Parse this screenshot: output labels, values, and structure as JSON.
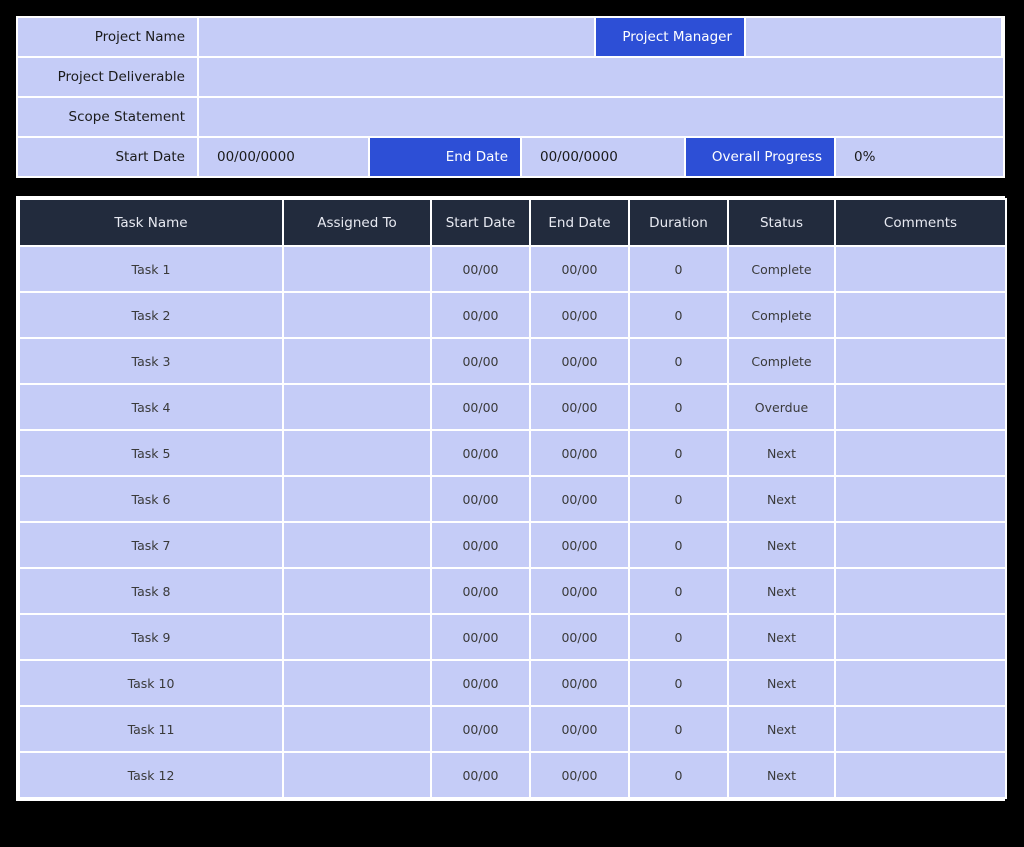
{
  "summary": {
    "rows": [
      {
        "label": "Project Name",
        "value": "",
        "accent_label": "Project Manager",
        "accent_value": ""
      },
      {
        "label": "Project Deliverable",
        "value": ""
      },
      {
        "label": "Scope Statement",
        "value": ""
      },
      {
        "label": "Start Date",
        "value": "00/00/0000",
        "end_date_label": "End Date",
        "end_date_value": "00/00/0000",
        "progress_label": "Overall Progress",
        "progress_value": "0%"
      }
    ]
  },
  "task_table": {
    "columns": [
      "Task Name",
      "Assigned To",
      "Start Date",
      "End Date",
      "Duration",
      "Status",
      "Comments"
    ],
    "rows": [
      {
        "task": "Task 1",
        "assigned": "",
        "start": "00/00",
        "end": "00/00",
        "duration": "0",
        "status": "Complete",
        "comments": ""
      },
      {
        "task": "Task 2",
        "assigned": "",
        "start": "00/00",
        "end": "00/00",
        "duration": "0",
        "status": "Complete",
        "comments": ""
      },
      {
        "task": "Task 3",
        "assigned": "",
        "start": "00/00",
        "end": "00/00",
        "duration": "0",
        "status": "Complete",
        "comments": ""
      },
      {
        "task": "Task 4",
        "assigned": "",
        "start": "00/00",
        "end": "00/00",
        "duration": "0",
        "status": "Overdue",
        "comments": ""
      },
      {
        "task": "Task 5",
        "assigned": "",
        "start": "00/00",
        "end": "00/00",
        "duration": "0",
        "status": "Next",
        "comments": ""
      },
      {
        "task": "Task 6",
        "assigned": "",
        "start": "00/00",
        "end": "00/00",
        "duration": "0",
        "status": "Next",
        "comments": ""
      },
      {
        "task": "Task 7",
        "assigned": "",
        "start": "00/00",
        "end": "00/00",
        "duration": "0",
        "status": "Next",
        "comments": ""
      },
      {
        "task": "Task 8",
        "assigned": "",
        "start": "00/00",
        "end": "00/00",
        "duration": "0",
        "status": "Next",
        "comments": ""
      },
      {
        "task": "Task 9",
        "assigned": "",
        "start": "00/00",
        "end": "00/00",
        "duration": "0",
        "status": "Next",
        "comments": ""
      },
      {
        "task": "Task 10",
        "assigned": "",
        "start": "00/00",
        "end": "00/00",
        "duration": "0",
        "status": "Next",
        "comments": ""
      },
      {
        "task": "Task 11",
        "assigned": "",
        "start": "00/00",
        "end": "00/00",
        "duration": "0",
        "status": "Next",
        "comments": ""
      },
      {
        "task": "Task 12",
        "assigned": "",
        "start": "00/00",
        "end": "00/00",
        "duration": "0",
        "status": "Next",
        "comments": ""
      }
    ]
  },
  "colors": {
    "accent_blue": "#2d4fd6",
    "cell_lavender": "#c5ccf7",
    "header_navy": "#222b3d",
    "page_background": "#000000",
    "grid_line": "#ffffff"
  }
}
